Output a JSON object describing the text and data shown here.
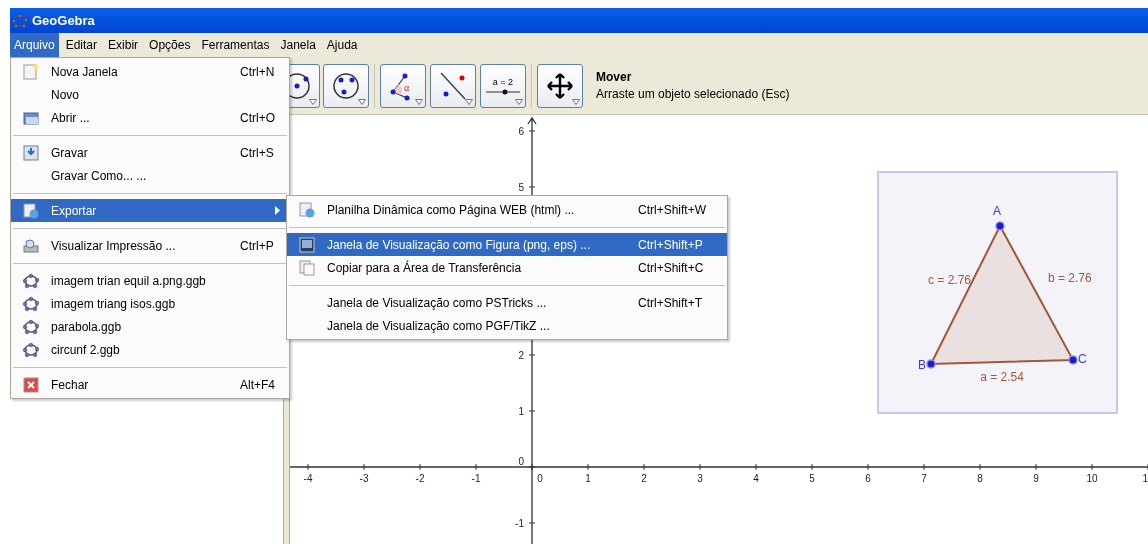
{
  "window": {
    "title": "GeoGebra"
  },
  "menu_bar": [
    {
      "label": "Arquivo",
      "selected": true
    },
    {
      "label": "Editar",
      "selected": false
    },
    {
      "label": "Exibir",
      "selected": false
    },
    {
      "label": "Opções",
      "selected": false
    },
    {
      "label": "Ferramentas",
      "selected": false
    },
    {
      "label": "Janela",
      "selected": false
    },
    {
      "label": "Ajuda",
      "selected": false
    }
  ],
  "file_menu": [
    {
      "kind": "item",
      "label": "Nova Janela",
      "shortcut": "Ctrl+N",
      "selected": false
    },
    {
      "kind": "item",
      "label": "Novo",
      "selected": false
    },
    {
      "kind": "item",
      "label": "Abrir ...",
      "shortcut": "Ctrl+O",
      "selected": false
    },
    {
      "kind": "separator"
    },
    {
      "kind": "item",
      "label": "Gravar",
      "shortcut": "Ctrl+S",
      "selected": false
    },
    {
      "kind": "item",
      "label": "Gravar Como... ...",
      "selected": false
    },
    {
      "kind": "separator"
    },
    {
      "kind": "submenu",
      "label": "Exportar",
      "selected": true
    },
    {
      "kind": "separator"
    },
    {
      "kind": "item",
      "label": "Visualizar Impressão ...",
      "shortcut": "Ctrl+P",
      "selected": false
    },
    {
      "kind": "separator"
    },
    {
      "kind": "recent",
      "label": "imagem trian equil a.png.ggb",
      "selected": false
    },
    {
      "kind": "recent",
      "label": "imagem triang isos.ggb",
      "selected": false
    },
    {
      "kind": "recent",
      "label": "parabola.ggb",
      "selected": false
    },
    {
      "kind": "recent",
      "label": "circunf 2.ggb",
      "selected": false
    },
    {
      "kind": "separator"
    },
    {
      "kind": "item",
      "label": "Fechar",
      "shortcut": "Alt+F4",
      "selected": false
    }
  ],
  "export_menu": [
    {
      "kind": "item",
      "label": "Planilha Dinâmica como Página WEB (html) ...",
      "shortcut": "Ctrl+Shift+W",
      "selected": false
    },
    {
      "kind": "separator"
    },
    {
      "kind": "item",
      "label": "Janela de Visualização como Figura (png, eps) ...",
      "shortcut": "Ctrl+Shift+P",
      "selected": true
    },
    {
      "kind": "item",
      "label": "Copiar para a Área de Transferência",
      "shortcut": "Ctrl+Shift+C",
      "selected": false
    },
    {
      "kind": "separator"
    },
    {
      "kind": "item",
      "label": "Janela de Visualização como PSTricks ...",
      "shortcut": "Ctrl+Shift+T",
      "selected": false
    },
    {
      "kind": "item",
      "label": "Janela de Visualização como PGF/TikZ ...",
      "selected": false
    }
  ],
  "toolbar": {
    "tools": [
      {
        "kind": "circle-center"
      },
      {
        "kind": "circle-points"
      },
      {
        "kind": "angle",
        "label": "α"
      },
      {
        "kind": "reflect"
      },
      {
        "kind": "slider",
        "label": "a = 2"
      },
      {
        "kind": "move"
      }
    ],
    "help": {
      "title": "Mover",
      "text": "Arraste um objeto selecionado (Esc)"
    }
  },
  "graphics": {
    "x_ticks": [
      "-4",
      "-3",
      "-2",
      "-1",
      "0",
      "1",
      "2",
      "3",
      "4",
      "5",
      "6",
      "7",
      "8",
      "9",
      "10",
      "1"
    ],
    "y_ticks": [
      "6",
      "5",
      "2",
      "1",
      "0",
      "-1"
    ],
    "triangle": {
      "points": [
        "A",
        "B",
        "C"
      ],
      "sides": [
        "c = 2.76",
        "b = 2.76",
        "a = 2.54"
      ]
    }
  }
}
